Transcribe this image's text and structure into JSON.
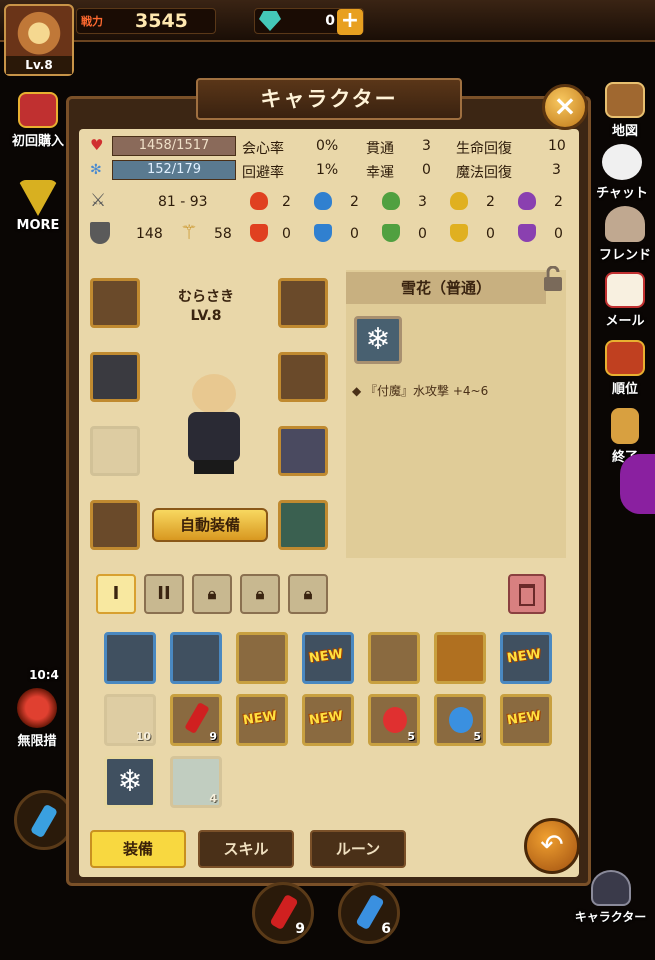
{
  "header": {
    "player_level": "Lv.8",
    "power_label": "戦力",
    "power_value": "3545",
    "gem_value": "0",
    "add_label": "+"
  },
  "left_menu": {
    "first_purchase": "初回購入",
    "more": "MORE",
    "timer": "10:4",
    "endless": "無限措"
  },
  "right_menu": {
    "map": "地図",
    "chat": "チャット",
    "friend": "フレンド",
    "mail": "メール",
    "rank": "順位",
    "exit": "終了",
    "character": "キャラクター"
  },
  "panel": {
    "title": "キャラクター",
    "close_label": "×"
  },
  "stats": {
    "hp": "1458/1517",
    "mp": "152/179",
    "attack": "81 - 93",
    "defense": "148",
    "magic": "58",
    "crit_label": "会心率",
    "crit_value": "0%",
    "pierce_label": "貫通",
    "pierce_value": "3",
    "hp_regen_label": "生命回復",
    "hp_regen_value": "10",
    "evade_label": "回避率",
    "evade_value": "1%",
    "luck_label": "幸運",
    "luck_value": "0",
    "mp_regen_label": "魔法回復",
    "mp_regen_value": "3",
    "elem_attack": [
      "2",
      "2",
      "3",
      "2",
      "2"
    ],
    "elem_resist": [
      "0",
      "0",
      "0",
      "0",
      "0"
    ]
  },
  "character": {
    "name": "むらさき",
    "level": "LV.8",
    "auto_equip_label": "自動装備"
  },
  "detail": {
    "item_name": "雪花（普通）",
    "attribute": "『付魔』水攻撃 +4~6"
  },
  "tabs": {
    "tab1": "I",
    "tab2": "II"
  },
  "inventory": {
    "new_badge": "NEW",
    "qty_10": "10",
    "qty_9": "9",
    "qty_5a": "5",
    "qty_5b": "5",
    "qty_4": "4"
  },
  "bottom_tabs": {
    "equip": "装備",
    "skill": "スキル",
    "rune": "ルーン"
  },
  "potions": {
    "red": "9",
    "blue": "6"
  },
  "colors": {
    "accent": "#f8d840",
    "panel_bg": "#e9d7a9",
    "frame": "#3c2614"
  }
}
